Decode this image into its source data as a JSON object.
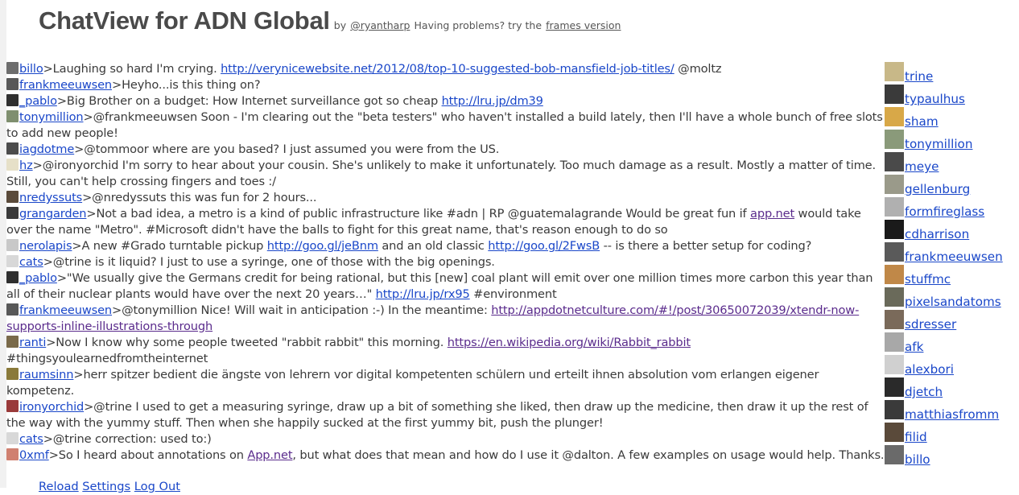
{
  "header": {
    "title": "ChatView for ADN Global",
    "by": "by",
    "author": "@ryantharp",
    "problems": "Having problems? try the",
    "frames_link": "frames version"
  },
  "messages": [
    {
      "user": "billo",
      "segs": [
        {
          "t": ">Laughing so hard I'm crying. "
        },
        {
          "t": "http://verynicewebsite.net/2012/08/top-10-suggested-bob-mansfield-job-titles/",
          "link": true
        },
        {
          "t": " @moltz"
        }
      ]
    },
    {
      "user": "frankmeeuwsen",
      "segs": [
        {
          "t": ">Heyho...is this thing on?"
        }
      ]
    },
    {
      "user": "_pablo",
      "segs": [
        {
          "t": ">Big Brother on a budget: How Internet surveillance got so cheap "
        },
        {
          "t": "http://lru.jp/dm39",
          "link": true
        }
      ]
    },
    {
      "user": "tonymillion",
      "segs": [
        {
          "t": ">@frankmeeuwsen Soon - I'm clearing out the \"beta testers\" who haven't installed a build lately, then I'll have a whole bunch of free slots to add new people!"
        }
      ]
    },
    {
      "user": "iagdotme",
      "segs": [
        {
          "t": ">@tommoor where are you based? I just assumed you were from the US."
        }
      ]
    },
    {
      "user": "hz",
      "segs": [
        {
          "t": ">@ironyorchid I'm sorry to hear about your cousin. She's unlikely to make it unfortunately. Too much damage as a result. Mostly a matter of time. Still, you can't help crossing fingers and toes :/"
        }
      ]
    },
    {
      "user": "nredyssuts",
      "segs": [
        {
          "t": ">@nredyssuts this was fun for 2 hours..."
        }
      ]
    },
    {
      "user": "grangarden",
      "segs": [
        {
          "t": ">Not a bad idea, a metro is a kind of public infrastructure like #adn | RP @guatemalagrande Would be great fun if "
        },
        {
          "t": "app.net",
          "link": true,
          "visited": true
        },
        {
          "t": " would take over the name \"Metro\". #Microsoft didn't have the balls to fight for this great name, that's reason enough to do so"
        }
      ]
    },
    {
      "user": "nerolapis",
      "segs": [
        {
          "t": ">A new #Grado turntable pickup "
        },
        {
          "t": "http://goo.gl/jeBnm",
          "link": true
        },
        {
          "t": " and an old classic "
        },
        {
          "t": "http://goo.gl/2FwsB",
          "link": true
        },
        {
          "t": " -- is there a better setup for coding?"
        }
      ]
    },
    {
      "user": "cats",
      "segs": [
        {
          "t": ">@trine is it liquid? I just to use a syringe, one of those with the big openings."
        }
      ]
    },
    {
      "user": "_pablo",
      "segs": [
        {
          "t": ">\"We usually give the Germans credit for being rational, but this [new] coal plant will emit over one million times more carbon this year than all of their nuclear plants would have over the next 20 years…\" "
        },
        {
          "t": "http://lru.jp/rx95",
          "link": true
        },
        {
          "t": " #environment"
        }
      ]
    },
    {
      "user": "frankmeeuwsen",
      "segs": [
        {
          "t": ">@tonymillion Nice! Will wait in anticipation :-) In the meantime: "
        },
        {
          "t": "http://appdotnetculture.com/#!/post/30650072039/xtendr-now-supports-inline-illustrations-through",
          "link": true,
          "visited": true
        }
      ]
    },
    {
      "user": "ranti",
      "segs": [
        {
          "t": ">Now I know why some people tweeted \"rabbit rabbit\" this morning. "
        },
        {
          "t": "https://en.wikipedia.org/wiki/Rabbit_rabbit",
          "link": true,
          "visited": true
        },
        {
          "t": " #thingsyoulearnedfromtheinternet"
        }
      ]
    },
    {
      "user": "raumsinn",
      "segs": [
        {
          "t": ">herr spitzer bedient die ängste von lehrern vor digital kompetenten schülern und erteilt ihnen absolution vom erlangen eigener kompetenz."
        }
      ]
    },
    {
      "user": "ironyorchid",
      "segs": [
        {
          "t": ">@trine I used to get a measuring syringe, draw up a bit of something she liked, then draw up the medicine, then draw it up the rest of the way with the yummy stuff. Then when she happily sucked at the first yummy bit, push the plunger!"
        }
      ]
    },
    {
      "user": "cats",
      "segs": [
        {
          "t": ">@trine correction: used to:)"
        }
      ]
    },
    {
      "user": "0xmf",
      "segs": [
        {
          "t": ">So I heard about annotations on "
        },
        {
          "t": "App.net",
          "link": true,
          "visited": true
        },
        {
          "t": ", but what does that mean and how do I use it @dalton. A few examples on usage would help. Thanks."
        }
      ]
    }
  ],
  "avatar_colors": {
    "billo": "#6d6d6d",
    "frankmeeuwsen": "#585858",
    "_pablo": "#2f2f2f",
    "tonymillion": "#7f8f6f",
    "iagdotme": "#4c4c4c",
    "hz": "#e6e0c8",
    "nredyssuts": "#5a4a3a",
    "grangarden": "#3a3a3a",
    "nerolapis": "#c8c8c8",
    "cats": "#d8d8d8",
    "ranti": "#7a6a4a",
    "raumsinn": "#8a7a3a",
    "ironyorchid": "#9a3a3a",
    "0xmf": "#d08070"
  },
  "users": [
    {
      "name": "trine",
      "color": "#c8b888"
    },
    {
      "name": "typaulhus",
      "color": "#3a3a3a"
    },
    {
      "name": "sham",
      "color": "#d8a848"
    },
    {
      "name": "tonymillion",
      "color": "#8a9a7a"
    },
    {
      "name": "meye",
      "color": "#4a4a4a"
    },
    {
      "name": "gellenburg",
      "color": "#9a9a8a"
    },
    {
      "name": "formfireglass",
      "color": "#b0b0b0"
    },
    {
      "name": "cdharrison",
      "color": "#1a1a1a"
    },
    {
      "name": "frankmeeuwsen",
      "color": "#5a5a5a"
    },
    {
      "name": "stuffmc",
      "color": "#c08848"
    },
    {
      "name": "pixelsandatoms",
      "color": "#6a6a5a"
    },
    {
      "name": "sdresser",
      "color": "#7a6a5a"
    },
    {
      "name": "afk",
      "color": "#a8a8a8"
    },
    {
      "name": "alexbori",
      "color": "#d0d0d0"
    },
    {
      "name": "djetch",
      "color": "#2a2a2a"
    },
    {
      "name": "matthiasfromm",
      "color": "#3a3a3a"
    },
    {
      "name": "filid",
      "color": "#5a4a3a"
    },
    {
      "name": "billo",
      "color": "#6a6a6a"
    }
  ],
  "footer": {
    "reload": "Reload",
    "settings": "Settings",
    "logout": "Log Out"
  }
}
